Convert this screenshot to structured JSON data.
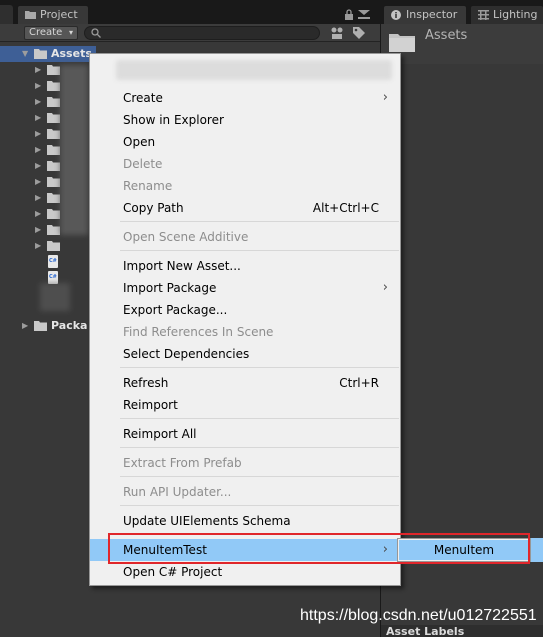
{
  "project_panel": {
    "tab_label": "Project",
    "create_label": "Create",
    "tree": [
      {
        "label": "Assets",
        "selected": true
      },
      {
        "label": "Packa",
        "selected": false
      }
    ],
    "file_icon_text": "C#"
  },
  "inspector_panel": {
    "tabs": [
      {
        "label": "Inspector",
        "icon": "info-icon"
      },
      {
        "label": "Lighting",
        "icon": "lighting-icon"
      }
    ],
    "header_title": "Assets",
    "asset_labels_title": "Asset Labels"
  },
  "context_menu": {
    "items": [
      {
        "label": "Create",
        "shortcut": "",
        "has_submenu": true,
        "disabled": false
      },
      {
        "label": "Show in Explorer",
        "shortcut": "",
        "has_submenu": false,
        "disabled": false
      },
      {
        "label": "Open",
        "shortcut": "",
        "has_submenu": false,
        "disabled": false
      },
      {
        "label": "Delete",
        "shortcut": "",
        "has_submenu": false,
        "disabled": true
      },
      {
        "label": "Rename",
        "shortcut": "",
        "has_submenu": false,
        "disabled": true
      },
      {
        "label": "Copy Path",
        "shortcut": "Alt+Ctrl+C",
        "has_submenu": false,
        "disabled": false
      },
      {
        "label": "Open Scene Additive",
        "shortcut": "",
        "has_submenu": false,
        "disabled": true
      },
      {
        "label": "Import New Asset...",
        "shortcut": "",
        "has_submenu": false,
        "disabled": false
      },
      {
        "label": "Import Package",
        "shortcut": "",
        "has_submenu": true,
        "disabled": false
      },
      {
        "label": "Export Package...",
        "shortcut": "",
        "has_submenu": false,
        "disabled": false
      },
      {
        "label": "Find References In Scene",
        "shortcut": "",
        "has_submenu": false,
        "disabled": true
      },
      {
        "label": "Select Dependencies",
        "shortcut": "",
        "has_submenu": false,
        "disabled": false
      },
      {
        "label": "Refresh",
        "shortcut": "Ctrl+R",
        "has_submenu": false,
        "disabled": false
      },
      {
        "label": "Reimport",
        "shortcut": "",
        "has_submenu": false,
        "disabled": false
      },
      {
        "label": "Reimport All",
        "shortcut": "",
        "has_submenu": false,
        "disabled": false
      },
      {
        "label": "Extract From Prefab",
        "shortcut": "",
        "has_submenu": false,
        "disabled": true
      },
      {
        "label": "Run API Updater...",
        "shortcut": "",
        "has_submenu": false,
        "disabled": true
      },
      {
        "label": "Update UIElements Schema",
        "shortcut": "",
        "has_submenu": false,
        "disabled": false
      },
      {
        "label": "MenuItemTest",
        "shortcut": "",
        "has_submenu": true,
        "disabled": false,
        "highlighted": true
      },
      {
        "label": "Open C# Project",
        "shortcut": "",
        "has_submenu": false,
        "disabled": false
      }
    ]
  },
  "submenu": {
    "items": [
      {
        "label": "MenuItem",
        "highlighted": true
      }
    ]
  },
  "watermark": "https://blog.csdn.net/u012722551",
  "colors": {
    "menu_bg": "#f0f0f0",
    "highlight": "#91c9f7",
    "annotation": "#e0262b",
    "selection": "#3e5f96",
    "panel_bg": "#383838"
  }
}
